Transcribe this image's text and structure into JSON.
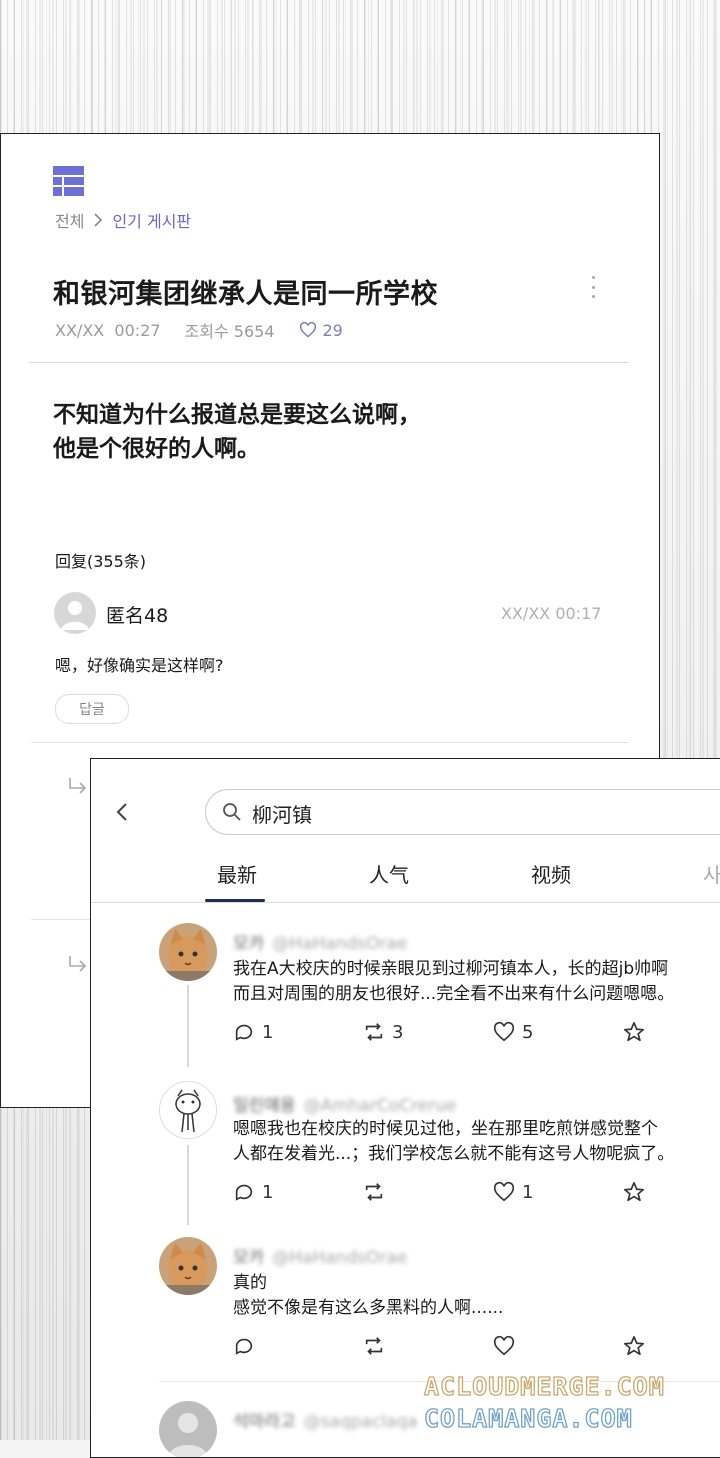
{
  "forum": {
    "breadcrumb": {
      "all": "전체",
      "current": "인기 게시판"
    },
    "post": {
      "title": "和银河集团继承人是同一所学校",
      "date": "XX/XX",
      "time": "00:27",
      "views_label": "조회수",
      "views": "5654",
      "likes": "29",
      "body_lines": [
        "不知道为什么报道总是要这么说啊，",
        "他是个很好的人啊。"
      ]
    },
    "replies_label": "回复(355条)",
    "comment": {
      "author": "匿名48",
      "timestamp": "XX/XX  00:17",
      "text": "嗯，好像确实是这样啊?",
      "reply_button": "답글"
    },
    "colors": {
      "accent": "#6b68c9",
      "logo": "#6f70d6"
    }
  },
  "search": {
    "query": "柳河镇",
    "tabs": [
      {
        "label": "最新",
        "active": true
      },
      {
        "label": "人气",
        "active": false
      },
      {
        "label": "视频",
        "active": false
      },
      {
        "label": "사",
        "active": false
      }
    ],
    "tweets": [
      {
        "name": "모카",
        "handle": "@HaHandsOrae",
        "lines": [
          "我在A大校庆的时候亲眼见到过柳河镇本人，长的超jb帅啊",
          "而且对周围的朋友也很好...完全看不出来有什么问题嗯嗯。"
        ],
        "replies": "1",
        "retweets": "3",
        "likes": "5"
      },
      {
        "name": "밀린얘용",
        "handle": "@AmharCoCrerue",
        "lines": [
          "嗯嗯我也在校庆的时候见过他，坐在那里吃煎饼感觉整个",
          "人都在发着光...；我们学校怎么就不能有这号人物呢疯了。"
        ],
        "replies": "1",
        "retweets": "",
        "likes": "1"
      },
      {
        "name": "모카",
        "handle": "@HaHandsOrae",
        "lines": [
          "真的",
          "感觉不像是有这么多黑料的人啊......"
        ],
        "replies": "",
        "retweets": "",
        "likes": ""
      },
      {
        "name": "석마라고",
        "handle": "@saqpaclaqa",
        "lines": [],
        "replies": "",
        "retweets": "",
        "likes": ""
      }
    ]
  },
  "watermark": {
    "line1": "ACLOUDMERGE.COM",
    "line2": "COLAMANGA.COM"
  }
}
